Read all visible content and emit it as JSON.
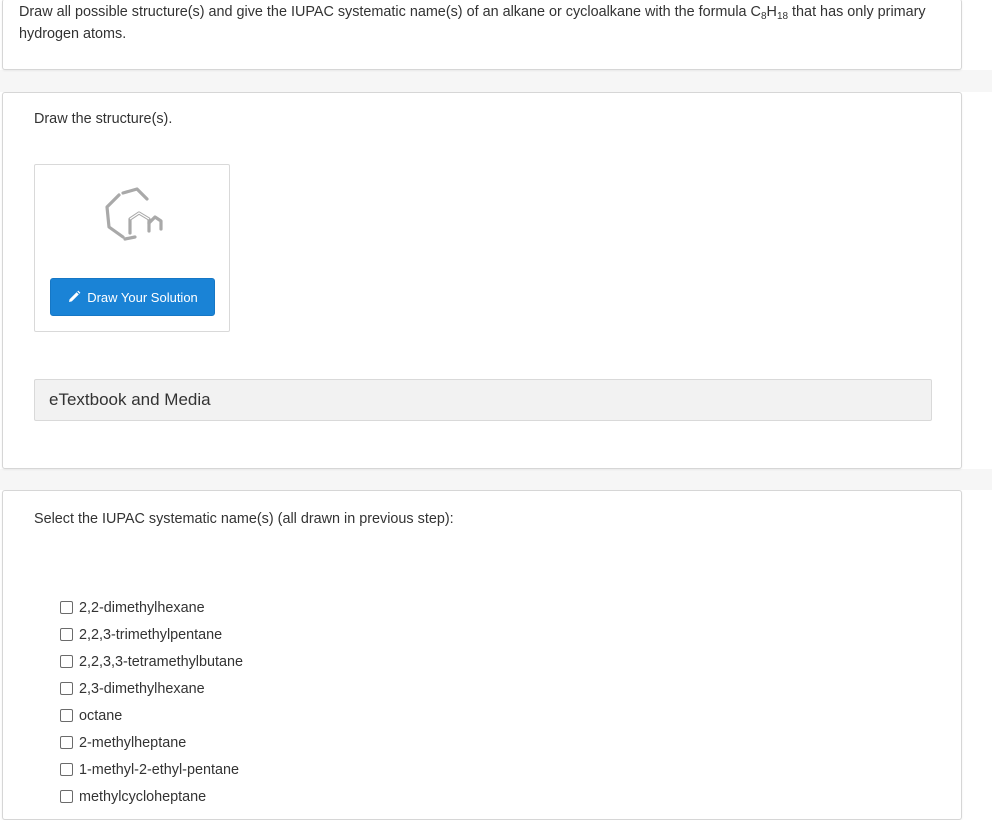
{
  "question": {
    "text_before": "Draw all possible structure(s) and give the IUPAC systematic name(s) of an alkane or cycloalkane with the formula C",
    "sub1": "8",
    "mid": "H",
    "sub2": "18",
    "text_after": " that has only primary hydrogen atoms."
  },
  "draw_section": {
    "label": "Draw the structure(s).",
    "icon": "chemistry-drawing-icon",
    "button_icon": "pencil-icon",
    "button_label": "Draw Your Solution",
    "etextbook_label": "eTextbook and Media"
  },
  "select_section": {
    "label": "Select the IUPAC systematic name(s) (all drawn in previous step):",
    "options": [
      {
        "label": "2,2-dimethylhexane",
        "checked": false
      },
      {
        "label": "2,2,3-trimethylpentane",
        "checked": false
      },
      {
        "label": "2,2,3,3-tetramethylbutane",
        "checked": false
      },
      {
        "label": "2,3-dimethylhexane",
        "checked": false
      },
      {
        "label": "octane",
        "checked": false
      },
      {
        "label": "2-methylheptane",
        "checked": false
      },
      {
        "label": "1-methyl-2-ethyl-pentane",
        "checked": false
      },
      {
        "label": "methylcycloheptane",
        "checked": false
      }
    ]
  },
  "colors": {
    "accent": "#1a83d6",
    "text": "#333333",
    "border": "#d6d6d6",
    "bar_background": "#f2f2f2"
  }
}
